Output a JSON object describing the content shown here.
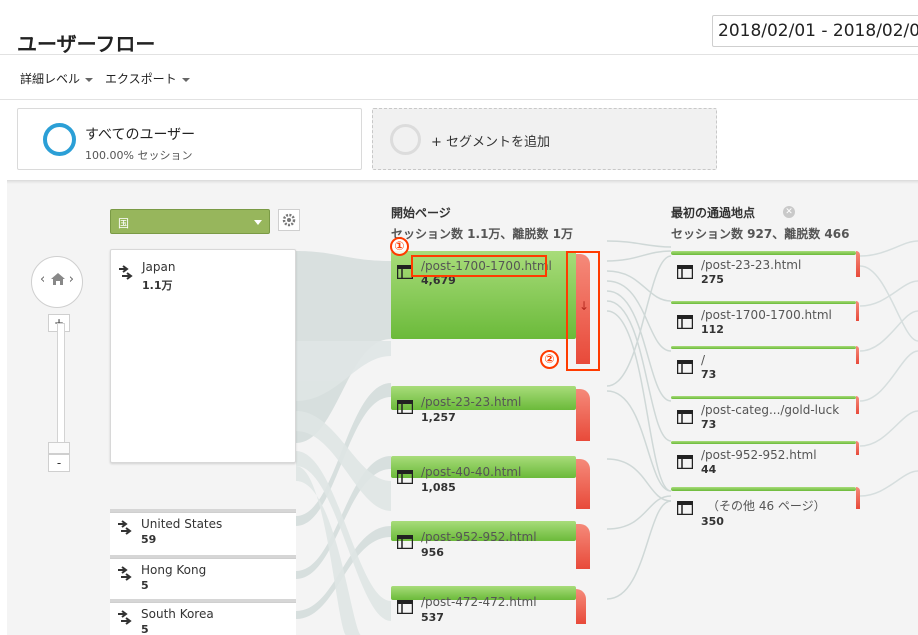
{
  "header": {
    "title": "ユーザーフロー",
    "date_range": "2018/02/01 - 2018/02/0"
  },
  "toolbar": {
    "detail_level": "詳細レベル",
    "export": "エクスポート"
  },
  "segment": {
    "name": "すべてのユーザー",
    "share": "100.00% セッション",
    "add_label": "+ セグメントを追加"
  },
  "dimension": {
    "label": "国"
  },
  "countries": [
    {
      "name": "Japan",
      "count": "1.1万"
    },
    {
      "name": "United States",
      "count": "59"
    },
    {
      "name": "Hong Kong",
      "count": "5"
    },
    {
      "name": "South Korea",
      "count": "5"
    }
  ],
  "start_column": {
    "title": "開始ページ",
    "subtitle": "セッション数 1.1万、離脱数 1万",
    "pages": [
      {
        "url": "/post-1700-1700.html",
        "count": "4,679"
      },
      {
        "url": "/post-23-23.html",
        "count": "1,257"
      },
      {
        "url": "/post-40-40.html",
        "count": "1,085"
      },
      {
        "url": "/post-952-952.html",
        "count": "956"
      },
      {
        "url": "/post-472-472.html",
        "count": "537"
      }
    ]
  },
  "step1_column": {
    "title": "最初の通過地点",
    "subtitle": "セッション数 927、離脱数 466",
    "pages": [
      {
        "url": "/post-23-23.html",
        "count": "275"
      },
      {
        "url": "/post-1700-1700.html",
        "count": "112"
      },
      {
        "url": "/",
        "count": "73"
      },
      {
        "url": "/post-categ.../gold-luck",
        "count": "73"
      },
      {
        "url": "/post-952-952.html",
        "count": "44"
      },
      {
        "url": "（その他 46 ページ）",
        "count": "350"
      }
    ]
  },
  "annotations": {
    "marker_1": "①",
    "marker_2": "②"
  },
  "colors": {
    "node_green": "#7cc44a",
    "dropoff_red": "#e84a3a",
    "highlight": "#ff3b00",
    "segment_ring": "#2b9fd6"
  }
}
